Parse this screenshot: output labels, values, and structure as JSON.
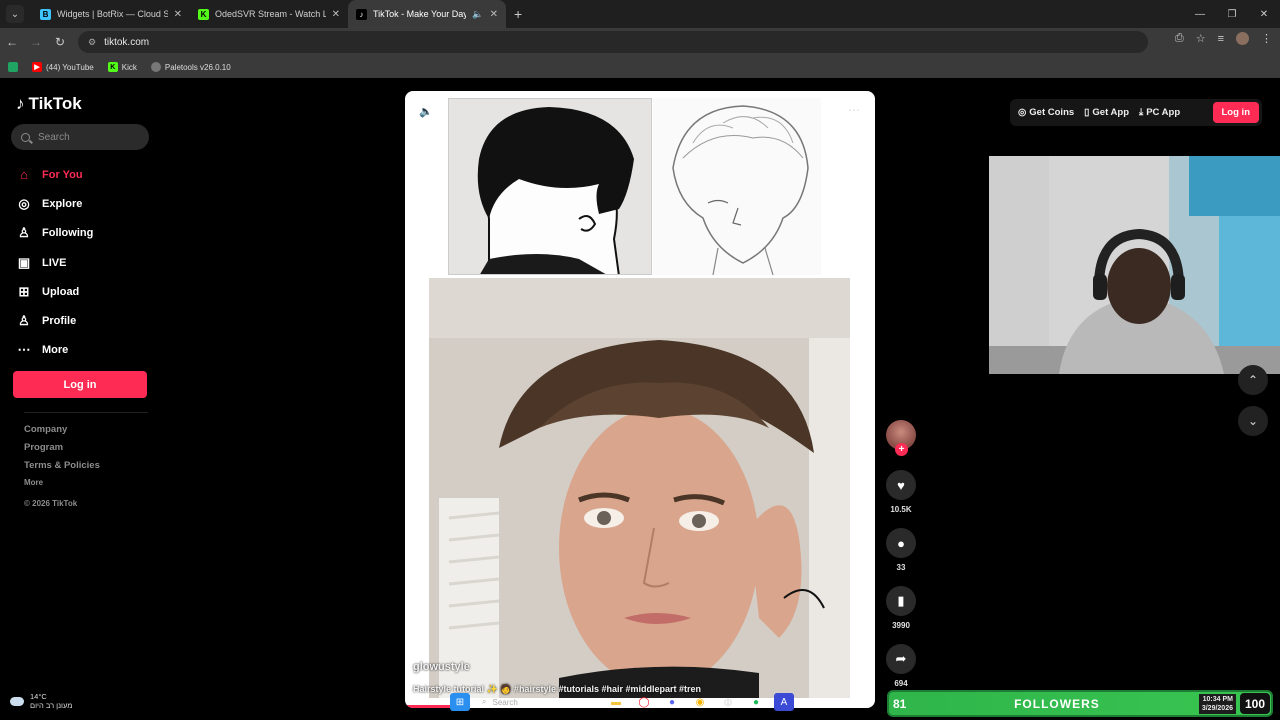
{
  "browser": {
    "tabs": [
      {
        "title": "Widgets | BotRix — Cloud Strea",
        "favicon": "B",
        "color": "#3ec5ff"
      },
      {
        "title": "OdedSVR Stream - Watch Live o",
        "favicon": "K",
        "color": "#53fc18"
      },
      {
        "title": "TikTok - Make Your Day",
        "favicon": "♪",
        "color": "#000000"
      }
    ],
    "url": "tiktok.com",
    "bookmarks": [
      {
        "label": "(44) YouTube",
        "color": "#ff0000"
      },
      {
        "label": "Kick",
        "color": "#53fc18"
      },
      {
        "label": "Paletools v26.0.10",
        "color": "#777777"
      }
    ]
  },
  "sidebar": {
    "logo": "TikTok",
    "search_placeholder": "Search",
    "nav": [
      {
        "label": "For You",
        "icon": "home-icon",
        "glyph": "⌂"
      },
      {
        "label": "Explore",
        "icon": "compass-icon",
        "glyph": "◎"
      },
      {
        "label": "Following",
        "icon": "user-icon",
        "glyph": "♙"
      },
      {
        "label": "LIVE",
        "icon": "tv-icon",
        "glyph": "▣"
      },
      {
        "label": "Upload",
        "icon": "plus-square-icon",
        "glyph": "⊞"
      },
      {
        "label": "Profile",
        "icon": "person-icon",
        "glyph": "♙"
      },
      {
        "label": "More",
        "icon": "dots-icon",
        "glyph": "⋯"
      }
    ],
    "login": "Log in",
    "footer": [
      "Company",
      "Program",
      "Terms & Policies"
    ],
    "footer_more": "More",
    "copyright": "© 2026 TikTok"
  },
  "video": {
    "username": "glowustyle",
    "caption": "Hairstyle tutorial ✨ 🧑 #hairstyle #tutorials #hair #middlepart #tren",
    "progress": 0.12
  },
  "actions": {
    "likes": "10.5K",
    "comments": "33",
    "saves": "3990",
    "shares": "694"
  },
  "topbar": {
    "get_coins": "Get Coins",
    "get_app": "Get App",
    "pc_app": "PC App",
    "login": "Log in"
  },
  "overlay": {
    "weather_temp": "14°C",
    "weather_text": "מעונן רב היום",
    "taskbar_search": "Search",
    "followers_left": "81",
    "followers_label": "FOLLOWERS",
    "followers_right": "100",
    "time": "10:34 PM",
    "date": "3/29/2026"
  },
  "colors": {
    "accent": "#fe2c55",
    "followers_green": "#39c552"
  }
}
